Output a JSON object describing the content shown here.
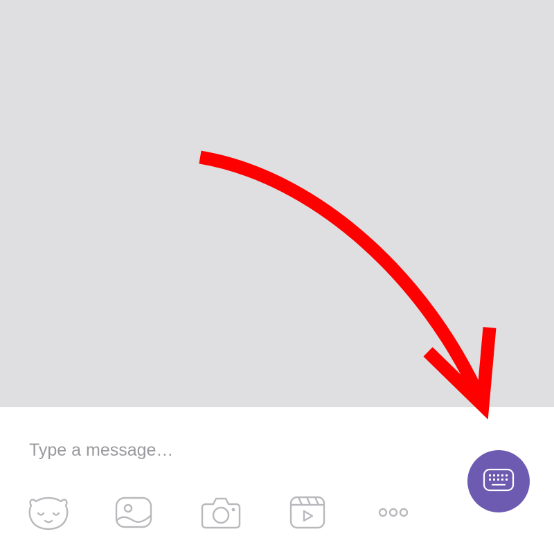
{
  "composer": {
    "placeholder": "Type a message…",
    "value": ""
  },
  "toolbar": {
    "items": [
      {
        "icon": "sticker-bear-icon"
      },
      {
        "icon": "gallery-icon"
      },
      {
        "icon": "camera-icon"
      },
      {
        "icon": "video-clip-icon"
      },
      {
        "icon": "more-icon"
      }
    ]
  },
  "keyboard_button": {
    "icon": "keyboard-icon"
  },
  "colors": {
    "chat_background": "#dfdfe1",
    "composer_background": "#ffffff",
    "icon_gray": "#b9b9bd",
    "accent": "#6c5bb0",
    "annotation_red": "#ff0000"
  },
  "annotation": {
    "type": "arrow",
    "points_to": "keyboard-button"
  }
}
